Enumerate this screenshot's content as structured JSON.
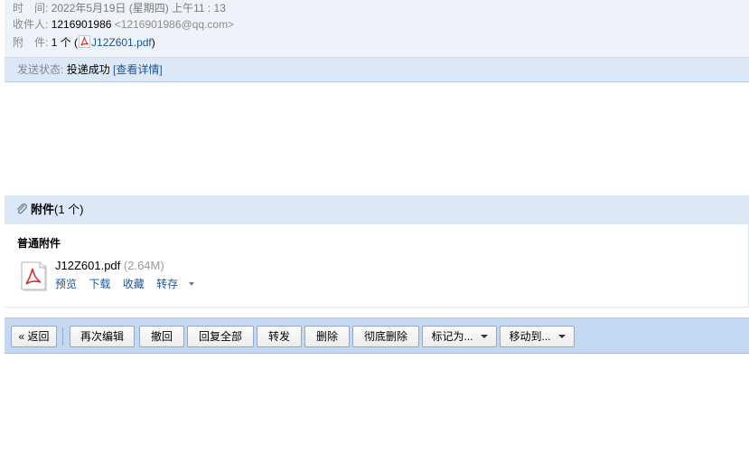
{
  "header": {
    "time_label": "时　间:",
    "time_value": "2022年5月19日 (星期四) 上午11 : 13",
    "recipient_label": "收件人:",
    "recipient_name": "1216901986",
    "recipient_email": "<1216901986@qq.com>",
    "attachment_label": "附　件:",
    "attachment_count": "1 个 (",
    "attachment_file": "J12Z601.pdf",
    "attachment_close": ")"
  },
  "status": {
    "label": "发送状态:",
    "value": "投递成功",
    "details_link": "[查看详情]"
  },
  "attachments": {
    "title": "附件",
    "count_text": "(1 个)",
    "section_label": "普通附件",
    "file": {
      "name": "J12Z601.pdf",
      "size": "(2.64M)",
      "actions": {
        "preview": "预览",
        "download": "下载",
        "favorite": "收藏",
        "save_to": "转存"
      },
      "icon": "pdf-icon"
    }
  },
  "toolbar": {
    "back": "« 返回",
    "edit_again": "再次编辑",
    "recall": "撤回",
    "reply_all": "回复全部",
    "forward": "转发",
    "delete": "删除",
    "delete_permanently": "彻底删除",
    "mark_as": "标记为...",
    "move_to": "移动到..."
  },
  "colors": {
    "header_bg": "#eef3fa",
    "bar_bg": "#dde8f6",
    "toolbar_bg": "#c5d8f1",
    "link": "#1e5494"
  }
}
